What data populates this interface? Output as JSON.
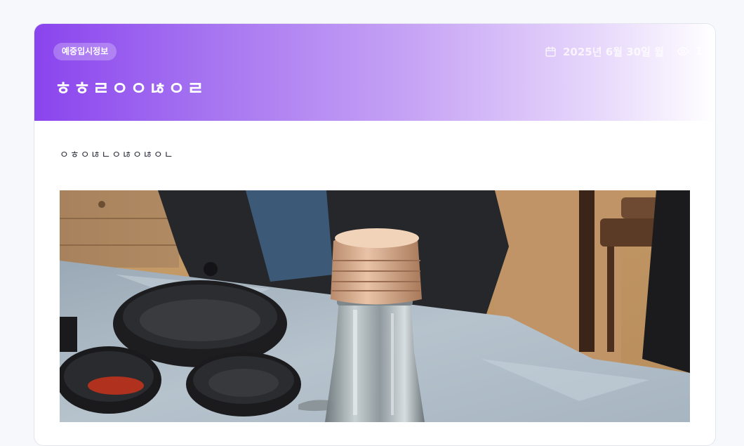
{
  "post": {
    "category_badge": "예중입시정보",
    "date": "2025년 6월 30일 월",
    "views": "1",
    "title": "ㅎㅎㄹㅇㅇㄶㅇㄹ",
    "body_text": "ㅇㅎㅇㄶㄴㅇㄶㅇㄶㅇㄴ"
  },
  "icons": {
    "date": "calendar-icon",
    "views": "eye-icon"
  },
  "colors": {
    "header_gradient_start": "#8a44ee",
    "header_gradient_end": "#ffffff",
    "page_background": "#f7f8fb",
    "body_text": "#2b2d3a"
  }
}
